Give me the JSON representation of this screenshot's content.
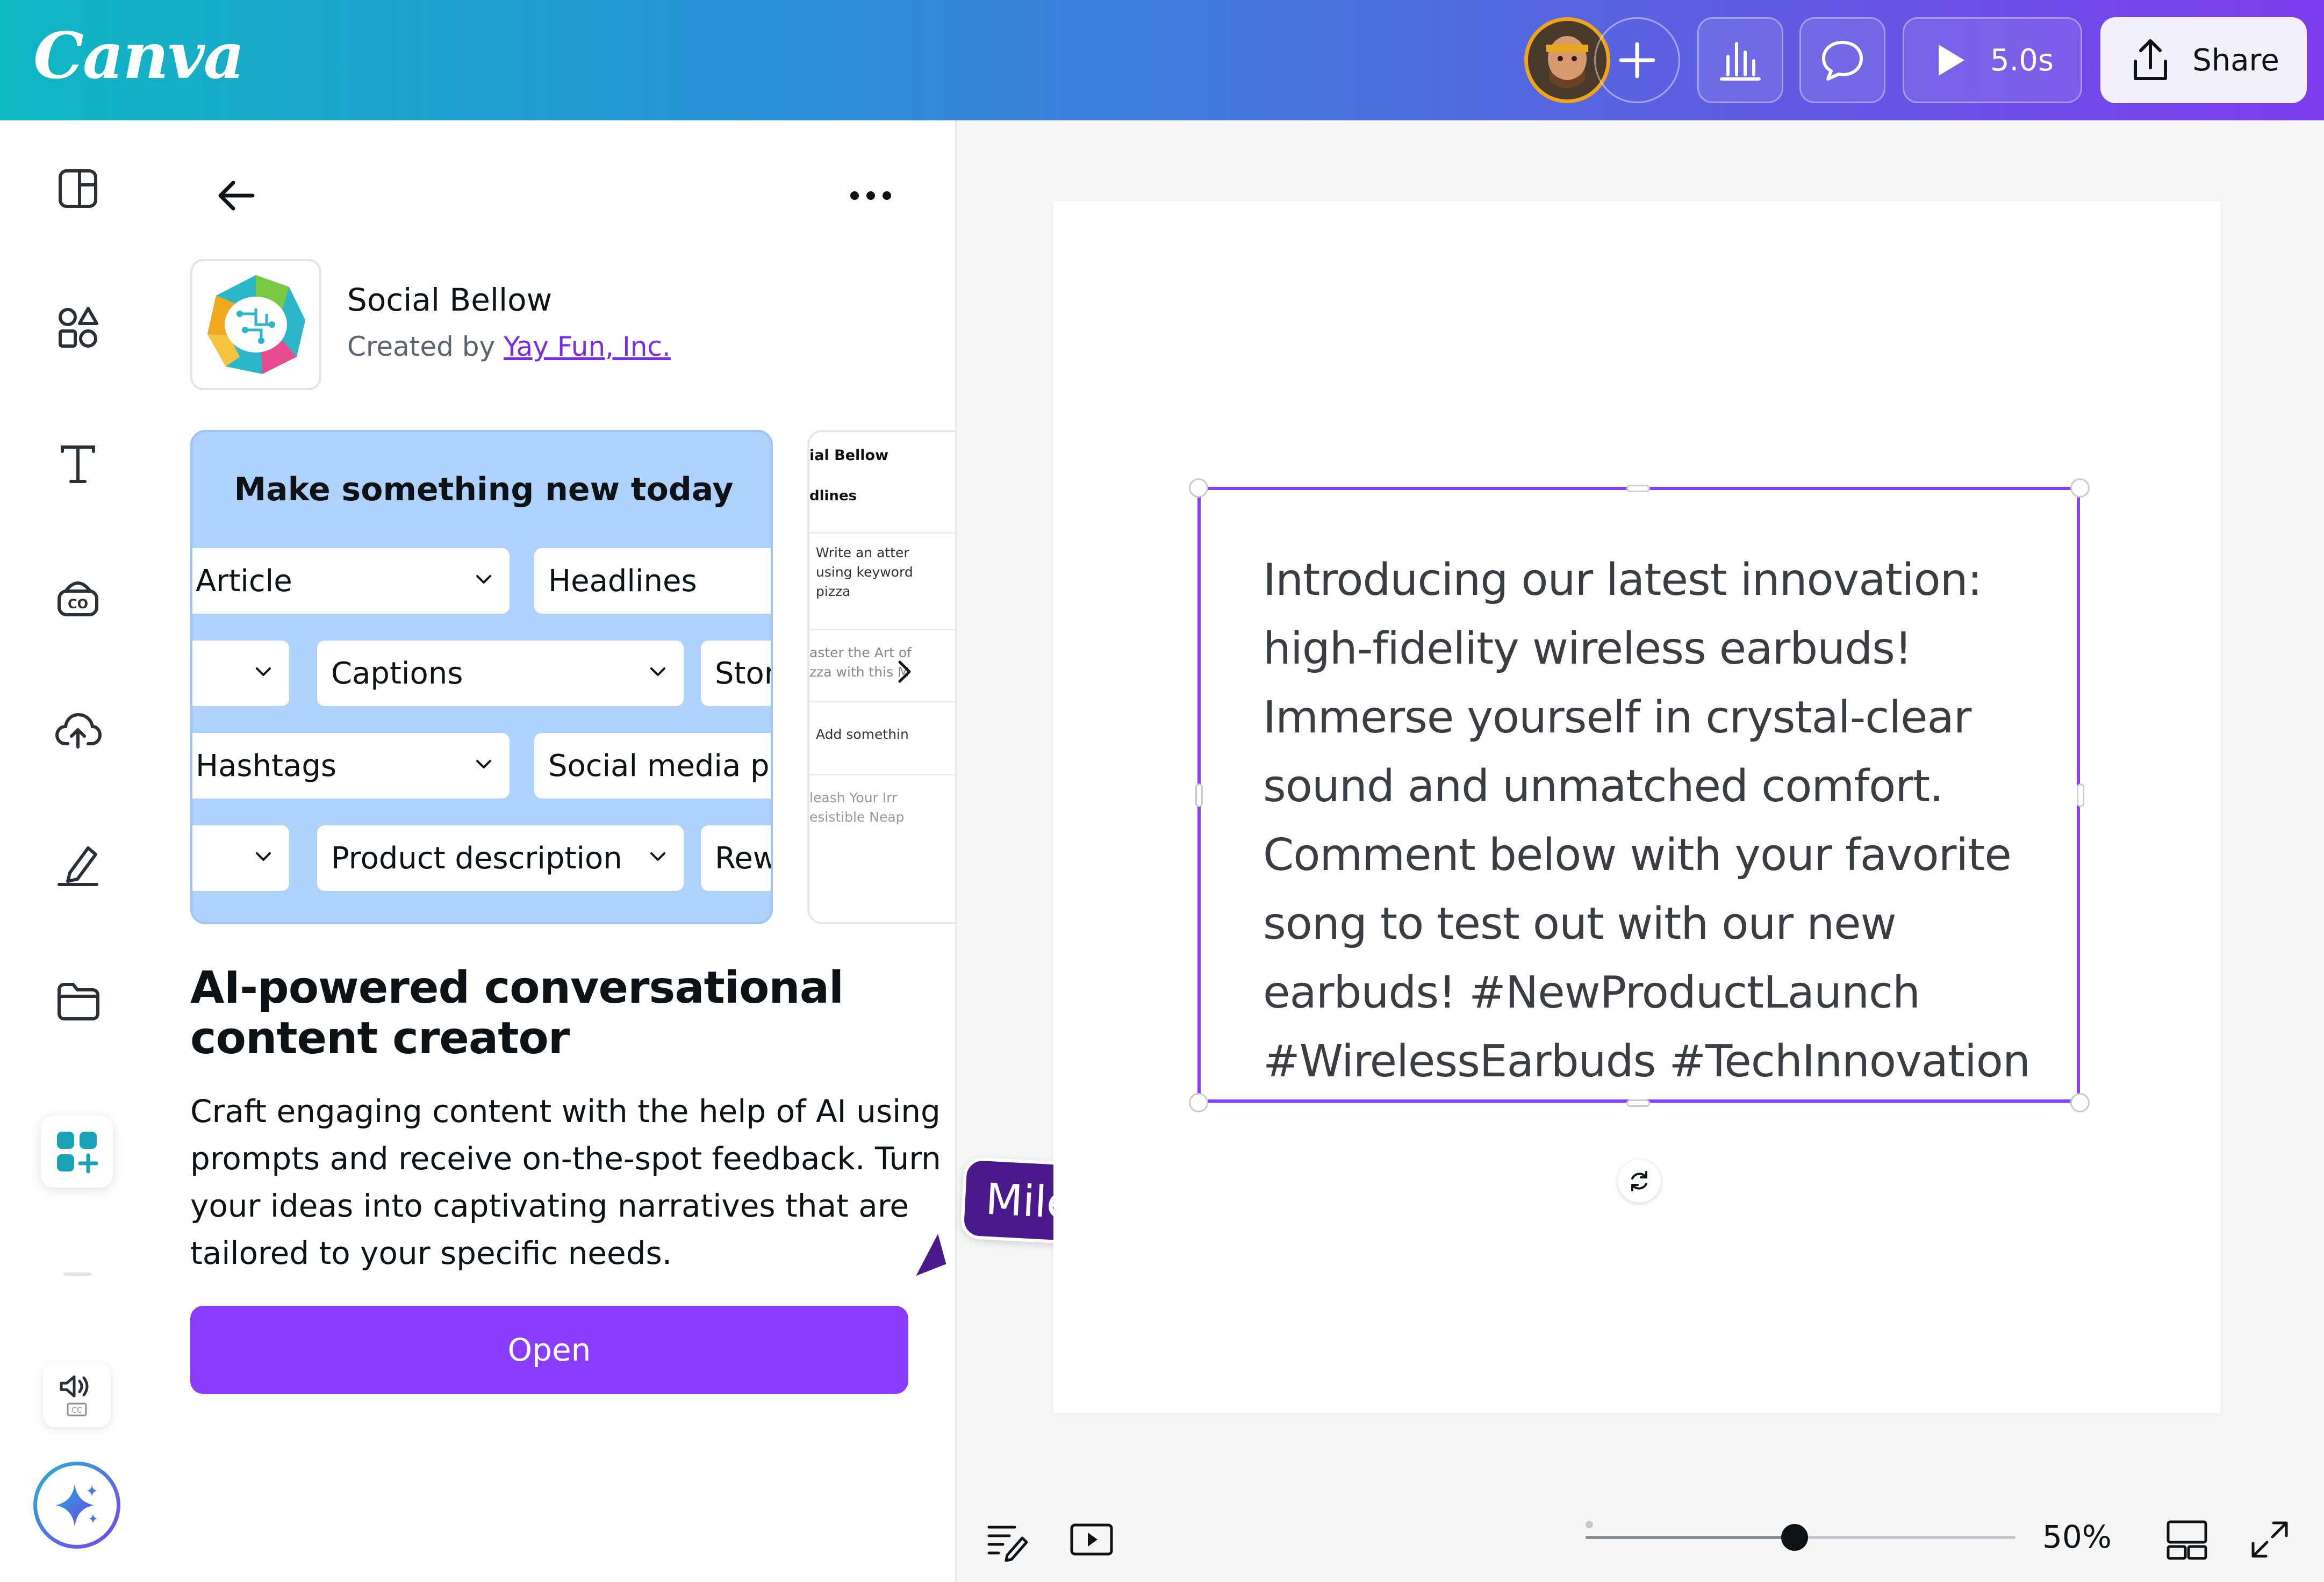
{
  "header": {
    "logo": "Canva",
    "timer_label": "5.0s",
    "share_label": "Share"
  },
  "panel": {
    "app_name": "Social Bellow",
    "created_by_prefix": "Created by ",
    "creator_name": "Yay Fun, Inc.",
    "preview_title": "Make something new today",
    "preview_chips": [
      "Article",
      "Headlines",
      "Captions",
      "Stor",
      "Hashtags",
      "Social media pos",
      "Product description",
      "Rew"
    ],
    "preview2": {
      "title": "ial Bellow",
      "subtitle": "dlines",
      "lines": [
        "Write an atter",
        "using keyword",
        "pizza",
        "aster the Art of",
        "zza with this M",
        "Add somethin",
        "leash Your Irr",
        "esistible Neap"
      ]
    },
    "headline": "AI-powered conversational content creator",
    "description": "Craft engaging content with the help of AI using prompts and receive on-the-spot feedback. Turn your ideas into captivating narratives that are tailored to your specific needs.",
    "open_label": "Open"
  },
  "collaborator": {
    "name": "Miles"
  },
  "canvas": {
    "text": "Introducing our latest innovation: high-fidelity wireless earbuds! Immerse yourself in crystal-clear sound and unmatched comfort. Comment below with your favorite song to test out with our new earbuds! #NewProductLaunch #WirelessEarbuds #TechInnovation"
  },
  "footer": {
    "zoom_label": "50%",
    "zoom_level_percent": 50
  },
  "colors": {
    "brand_purple": "#8b3dff",
    "selection": "#8b3dff",
    "link": "#7d2ae8",
    "collaborator": "#4a1a8c"
  }
}
